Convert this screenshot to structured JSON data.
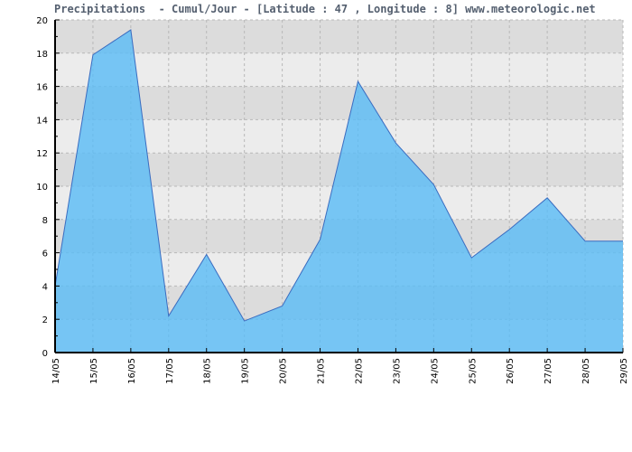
{
  "chart_data": {
    "type": "area",
    "title": "Precipitations  - Cumul/Jour - [Latitude : 47 , Longitude : 8] www.meteorologic.net",
    "xlabel": "",
    "ylabel": "",
    "ylim": [
      0,
      20
    ],
    "yticks": [
      "0",
      "2",
      "4",
      "6",
      "8",
      "10",
      "12",
      "14",
      "16",
      "18",
      "20"
    ],
    "categories": [
      "14/05",
      "15/05",
      "16/05",
      "17/05",
      "18/05",
      "19/05",
      "20/05",
      "21/05",
      "22/05",
      "23/05",
      "24/05",
      "25/05",
      "26/05",
      "27/05",
      "28/05",
      "29/05"
    ],
    "series": [
      {
        "name": "Precipitations",
        "values": [
          4.0,
          17.9,
          19.4,
          2.2,
          5.9,
          1.9,
          2.8,
          6.8,
          16.3,
          12.6,
          10.1,
          5.7,
          7.4,
          9.3,
          6.7,
          6.7
        ]
      }
    ],
    "grid": true,
    "legend": "none",
    "colors": {
      "fill": "#5bbcf5",
      "line": "#3a6cc0",
      "band_dark": "#dcdcdc",
      "band_light": "#ececec",
      "title": "#556070"
    }
  }
}
